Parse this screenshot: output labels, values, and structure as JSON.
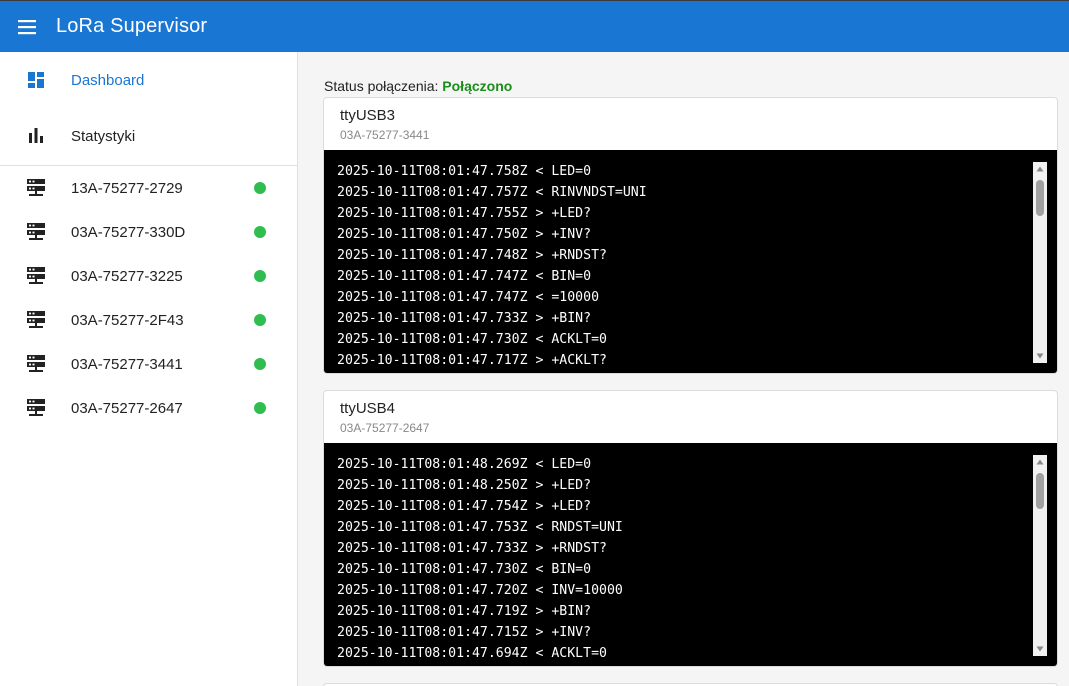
{
  "app": {
    "title": "LoRa Supervisor"
  },
  "nav": [
    {
      "label": "Dashboard",
      "icon": "dashboard-icon",
      "active": true
    },
    {
      "label": "Statystyki",
      "icon": "bar-chart-icon",
      "active": false
    }
  ],
  "devices": [
    {
      "label": "13A-75277-2729",
      "status": "online"
    },
    {
      "label": "03A-75277-330D",
      "status": "online"
    },
    {
      "label": "03A-75277-3225",
      "status": "online"
    },
    {
      "label": "03A-75277-2F43",
      "status": "online"
    },
    {
      "label": "03A-75277-3441",
      "status": "online"
    },
    {
      "label": "03A-75277-2647",
      "status": "online"
    }
  ],
  "colors": {
    "appbar": "#1976d2",
    "accent": "#1976d2",
    "online": "#2ebd4e",
    "connected": "#1a8f1a"
  },
  "status": {
    "label": "Status połączenia:",
    "value": "Połączono"
  },
  "cards": [
    {
      "title": "ttyUSB3",
      "subtitle": "03A-75277-3441",
      "lines": [
        "2025-10-11T08:01:47.758Z < LED=0",
        "2025-10-11T08:01:47.757Z < RINVNDST=UNI",
        "2025-10-11T08:01:47.755Z > +LED?",
        "2025-10-11T08:01:47.750Z > +INV?",
        "2025-10-11T08:01:47.748Z > +RNDST?",
        "2025-10-11T08:01:47.747Z < BIN=0",
        "2025-10-11T08:01:47.747Z < =10000",
        "2025-10-11T08:01:47.733Z > +BIN?",
        "2025-10-11T08:01:47.730Z < ACKLT=0",
        "2025-10-11T08:01:47.717Z > +ACKLT?"
      ]
    },
    {
      "title": "ttyUSB4",
      "subtitle": "03A-75277-2647",
      "lines": [
        "2025-10-11T08:01:48.269Z < LED=0",
        "2025-10-11T08:01:48.250Z > +LED?",
        "2025-10-11T08:01:47.754Z > +LED?",
        "2025-10-11T08:01:47.753Z < RNDST=UNI",
        "2025-10-11T08:01:47.733Z > +RNDST?",
        "2025-10-11T08:01:47.730Z < BIN=0",
        "2025-10-11T08:01:47.720Z < INV=10000",
        "2025-10-11T08:01:47.719Z > +BIN?",
        "2025-10-11T08:01:47.715Z > +INV?",
        "2025-10-11T08:01:47.694Z < ACKLT=0"
      ]
    }
  ]
}
